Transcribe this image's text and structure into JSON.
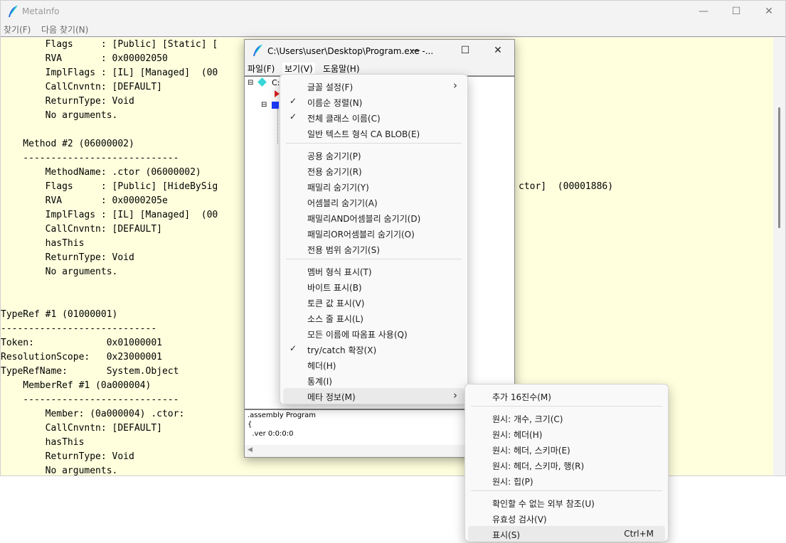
{
  "metainfo": {
    "title": "MetaInfo",
    "menu": [
      "찾기(F)",
      "다음 찾기(N)"
    ],
    "lines": [
      "        Flags     : [Public] [Static] [",
      "        RVA       : 0x00002050",
      "        ImplFlags : [IL] [Managed]  (00",
      "        CallCnvntn: [DEFAULT]",
      "        ReturnType: Void",
      "        No arguments.",
      "",
      "    Method #2 (06000002)",
      "    ----------------------------",
      "        MethodName: .ctor (06000002)",
      "        Flags     : [Public] [HideBySig",
      "        RVA       : 0x0000205e",
      "        ImplFlags : [IL] [Managed]  (00",
      "        CallCnvntn: [DEFAULT]",
      "        hasThis",
      "        ReturnType: Void",
      "        No arguments.",
      "",
      "",
      "TypeRef #1 (01000001)",
      "----------------------------",
      "Token:             0x01000001",
      "ResolutionScope:   0x23000001",
      "TypeRefName:       System.Object",
      "    MemberRef #1 (0a000004)",
      "    ----------------------------",
      "        Member: (0a000004) .ctor:",
      "        CallCnvntn: [DEFAULT]",
      "        hasThis",
      "        ReturnType: Void",
      "        No arguments."
    ],
    "right_fragment": "ctor]  (00001886)"
  },
  "ildasm": {
    "title": "C:\\Users\\user\\Desktop\\Program.exe -...",
    "menu": [
      "파일(F)",
      "보기(V)",
      "도움말(H)"
    ],
    "tree_root_label": "C:",
    "output_lines": [
      ".assembly Program",
      "{",
      "  .ver 0:0:0:0"
    ]
  },
  "view_menu": {
    "items": [
      {
        "label": "글꼴 설정(F)",
        "submenu": true
      },
      {
        "label": "이름순 정렬(N)",
        "checked": true
      },
      {
        "label": "전체 클래스 이름(C)",
        "checked": true
      },
      {
        "label": "일반 텍스트 형식 CA BLOB(E)"
      },
      {
        "sep": true
      },
      {
        "label": "공용 숨기기(P)"
      },
      {
        "label": "전용 숨기기(R)"
      },
      {
        "label": "패밀리 숨기기(Y)"
      },
      {
        "label": "어셈블리 숨기기(A)"
      },
      {
        "label": "패밀리AND어셈블리 숨기기(D)"
      },
      {
        "label": "패밀리OR어셈블리 숨기기(O)"
      },
      {
        "label": "전용 범위 숨기기(S)"
      },
      {
        "sep": true
      },
      {
        "label": "멤버 형식 표시(T)"
      },
      {
        "label": "바이트 표시(B)"
      },
      {
        "label": "토큰 값 표시(V)"
      },
      {
        "label": "소스 줄 표시(L)"
      },
      {
        "label": "모든 이름에 따옴표 사용(Q)"
      },
      {
        "label": "try/catch 확장(X)",
        "checked": true
      },
      {
        "label": "헤더(H)"
      },
      {
        "label": "통계(I)"
      },
      {
        "label": "메타 정보(M)",
        "submenu": true,
        "highlighted": true
      }
    ]
  },
  "meta_submenu": {
    "items": [
      {
        "label": "추가 16진수(M)"
      },
      {
        "sep": true
      },
      {
        "label": "원시: 개수, 크기(C)"
      },
      {
        "label": "원시: 헤더(H)"
      },
      {
        "label": "원시: 헤더, 스키마(E)"
      },
      {
        "label": "원시: 헤더, 스키마, 행(R)"
      },
      {
        "label": "원시: 힙(P)"
      },
      {
        "sep": true
      },
      {
        "label": "확인할 수 없는 외부 참조(U)"
      },
      {
        "label": "유효성 검사(V)"
      },
      {
        "label": "표시(S)",
        "shortcut": "Ctrl+M",
        "highlighted": true
      }
    ]
  },
  "colors": {
    "doc_background": "#ffffde",
    "menu_highlight": "#eaeaea",
    "icon_blue": "#1e6fe0",
    "icon_cyan": "#36d6d6",
    "icon_red": "#e02020"
  }
}
